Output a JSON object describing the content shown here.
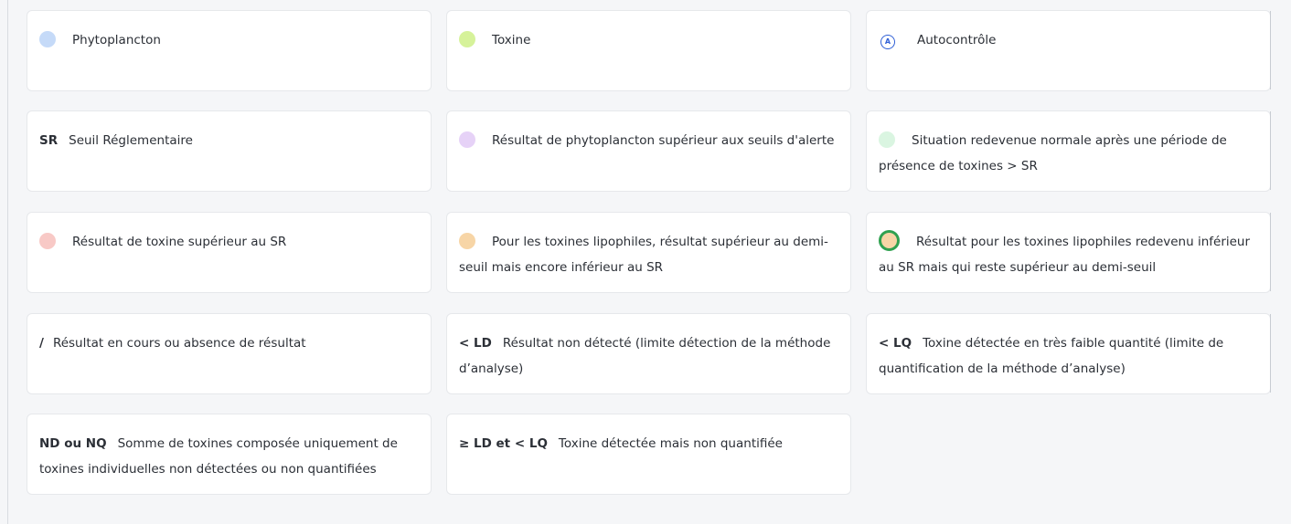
{
  "legend": {
    "phytoplancton": {
      "label": "Phytoplancton",
      "color": "#c5daf8"
    },
    "toxine": {
      "label": "Toxine",
      "color": "#d6f29a"
    },
    "autocontrole": {
      "label": "Autocontrôle",
      "icon_letter": "A",
      "icon": "circled-a-icon",
      "color": "#2f5fd6"
    },
    "sr": {
      "tag": "SR",
      "label": "Seuil Réglementaire"
    },
    "phyto_alert": {
      "label": "Résultat de phytoplancton supérieur aux seuils d'alerte",
      "color": "#e6d2f7"
    },
    "normal_again": {
      "label": "Situation redevenue normale après une période de présence de toxines > SR",
      "color": "#daf5e1"
    },
    "toxin_above_sr": {
      "label": "Résultat de toxine supérieur au SR",
      "color": "#f8c9c6"
    },
    "lipophile_half": {
      "label": "Pour les toxines lipophiles, résultat supérieur au demi-seuil mais encore inférieur au SR",
      "color": "#f7d5a6"
    },
    "lipophile_back": {
      "label": "Résultat pour les toxines lipophiles redevenu inférieur au SR mais qui reste supérieur au demi-seuil",
      "color": "#f7d5a6",
      "ring_color": "#2fa14f"
    },
    "in_progress": {
      "tag": "/",
      "label": "Résultat en cours ou absence de résultat"
    },
    "ld": {
      "tag": "< LD",
      "label": "Résultat non détecté (limite détection de la méthode d’analyse)"
    },
    "lq": {
      "tag": "< LQ",
      "label": "Toxine détectée en très faible quantité (limite de quantification de la méthode d’analyse)"
    },
    "nd_nq": {
      "tag": "ND ou NQ",
      "label": "Somme de toxines composée uniquement de toxines individuelles non détectées ou non quantifiées"
    },
    "ld_lq": {
      "tag": "≥ LD et < LQ",
      "label": "Toxine détectée mais non quantifiée"
    }
  }
}
